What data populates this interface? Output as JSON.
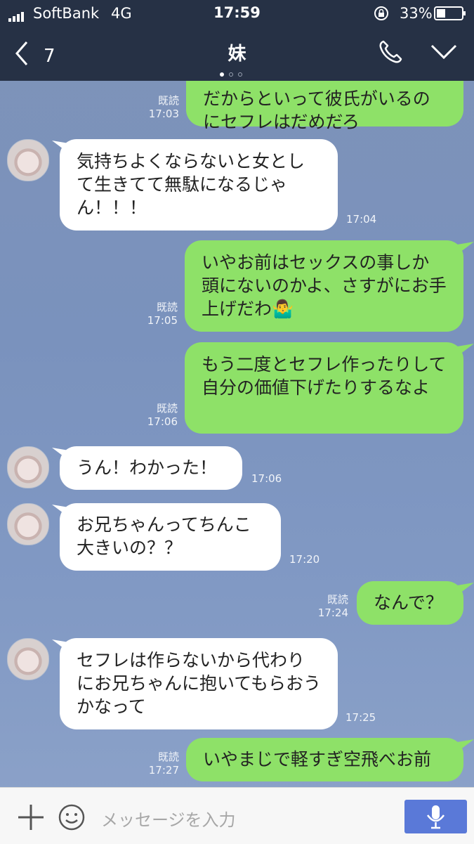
{
  "status": {
    "carrier": "SoftBank",
    "network": "4G",
    "time": "17:59",
    "battery": "33%"
  },
  "nav": {
    "back_count": "7",
    "title": "妹"
  },
  "messages": [
    {
      "side": "out",
      "text": "だからといって彼氏がいるのにセフレはだめだろ",
      "read": "既読",
      "time": "17:03"
    },
    {
      "side": "in",
      "text": "気持ちよくならないと女として生きてて無駄になるじゃん！！！",
      "time": "17:04"
    },
    {
      "side": "out",
      "text": "いやお前はセックスの事しか頭にないのかよ、さすがにお手上げだわ🤷‍♂️",
      "read": "既読",
      "time": "17:05"
    },
    {
      "side": "out",
      "text": "もう二度とセフレ作ったりして自分の価値下げたりするなよ",
      "read": "既読",
      "time": "17:06"
    },
    {
      "side": "in",
      "text": "うん！わかった！",
      "time": "17:06"
    },
    {
      "side": "in",
      "text": "お兄ちゃんってちんこ大きいの？？",
      "time": "17:20"
    },
    {
      "side": "out",
      "text": "なんで？",
      "read": "既読",
      "time": "17:24"
    },
    {
      "side": "in",
      "text": "セフレは作らないから代わりにお兄ちゃんに抱いてもらおうかなって",
      "time": "17:25"
    },
    {
      "side": "out",
      "text": "いやまじで軽すぎ空飛べお前",
      "read": "既読",
      "time": "17:27"
    }
  ],
  "input": {
    "placeholder": "メッセージを入力"
  },
  "icons": [
    "signal-icon",
    "lock-rotation-icon",
    "battery-icon",
    "back-chevron-icon",
    "phone-icon",
    "chevron-down-icon",
    "plus-icon",
    "emoji-icon",
    "mic-icon"
  ],
  "colors": {
    "header": "#263145",
    "outgoing": "#8ee168",
    "incoming": "#ffffff",
    "mic": "#5a79d8"
  }
}
